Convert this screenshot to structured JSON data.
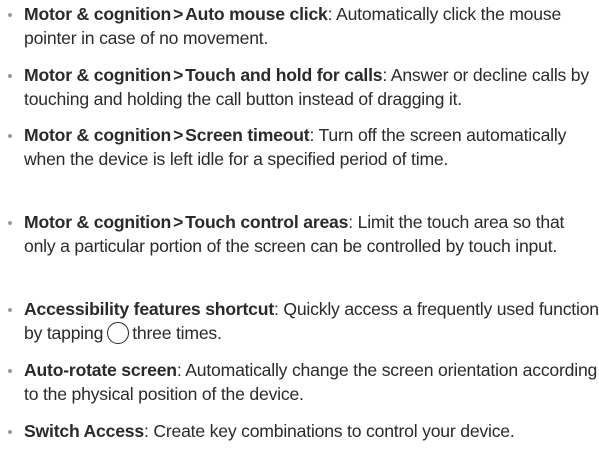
{
  "items": [
    {
      "bold_prefix": "Motor & cognition",
      "separator": ">",
      "bold_title": "Auto mouse click",
      "description": ": Automatically click the mouse pointer in case of no movement."
    },
    {
      "bold_prefix": "Motor & cognition",
      "separator": ">",
      "bold_title": "Touch and hold for calls",
      "description": ": Answer or decline calls by touching and holding the call button instead of dragging it."
    },
    {
      "bold_prefix": "Motor & cognition",
      "separator": ">",
      "bold_title": "Screen timeout",
      "description": ": Turn off the screen automatically when the device is left idle for a specified period of time."
    },
    {
      "bold_prefix": "Motor & cognition",
      "separator": ">",
      "bold_title": "Touch control areas",
      "description": ": Limit the touch area so that only a particular portion of the screen can be controlled by touch input."
    },
    {
      "bold_title": "Accessibility features shortcut",
      "description_before_icon": ": Quickly access a frequently used function by tapping",
      "icon": "home-button-icon",
      "description_after_icon": "three times."
    },
    {
      "bold_title": "Auto-rotate screen",
      "description": ": Automatically change the screen orientation according to the physical position of the device."
    },
    {
      "bold_title": "Switch Access",
      "description": ": Create key combinations to control your device."
    }
  ]
}
